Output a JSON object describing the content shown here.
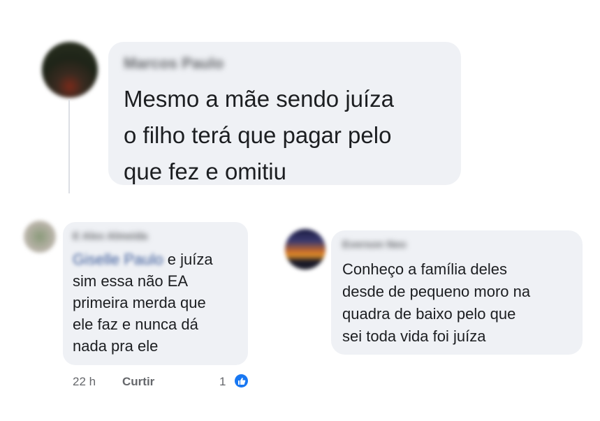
{
  "comments": [
    {
      "author": "Marcos Paulo",
      "lines": [
        "Mesmo a mãe sendo juíza",
        "o filho terá que pagar pelo",
        "que fez e omitiu"
      ]
    },
    {
      "author": "E Alex Almeida",
      "mention": "Giselle Paulo",
      "first_line_rest": "e juíza",
      "lines": [
        "sim  essa não EA",
        "primeira merda que",
        "ele faz e nunca dá",
        "nada pra ele"
      ],
      "time": "22 h",
      "like_action": "Curtir",
      "reaction_count": "1"
    },
    {
      "author": "Everson Neo",
      "lines": [
        "Conheço a família deles",
        "desde de pequeno moro na",
        "quadra de baixo pelo que",
        "sei toda vida foi juíza"
      ]
    }
  ],
  "colors": {
    "bubble": "#eff1f5",
    "text": "#1c1e21",
    "meta": "#65676b",
    "like": "#1877f2"
  },
  "icons": {
    "reaction": "thumbs-up-icon"
  }
}
